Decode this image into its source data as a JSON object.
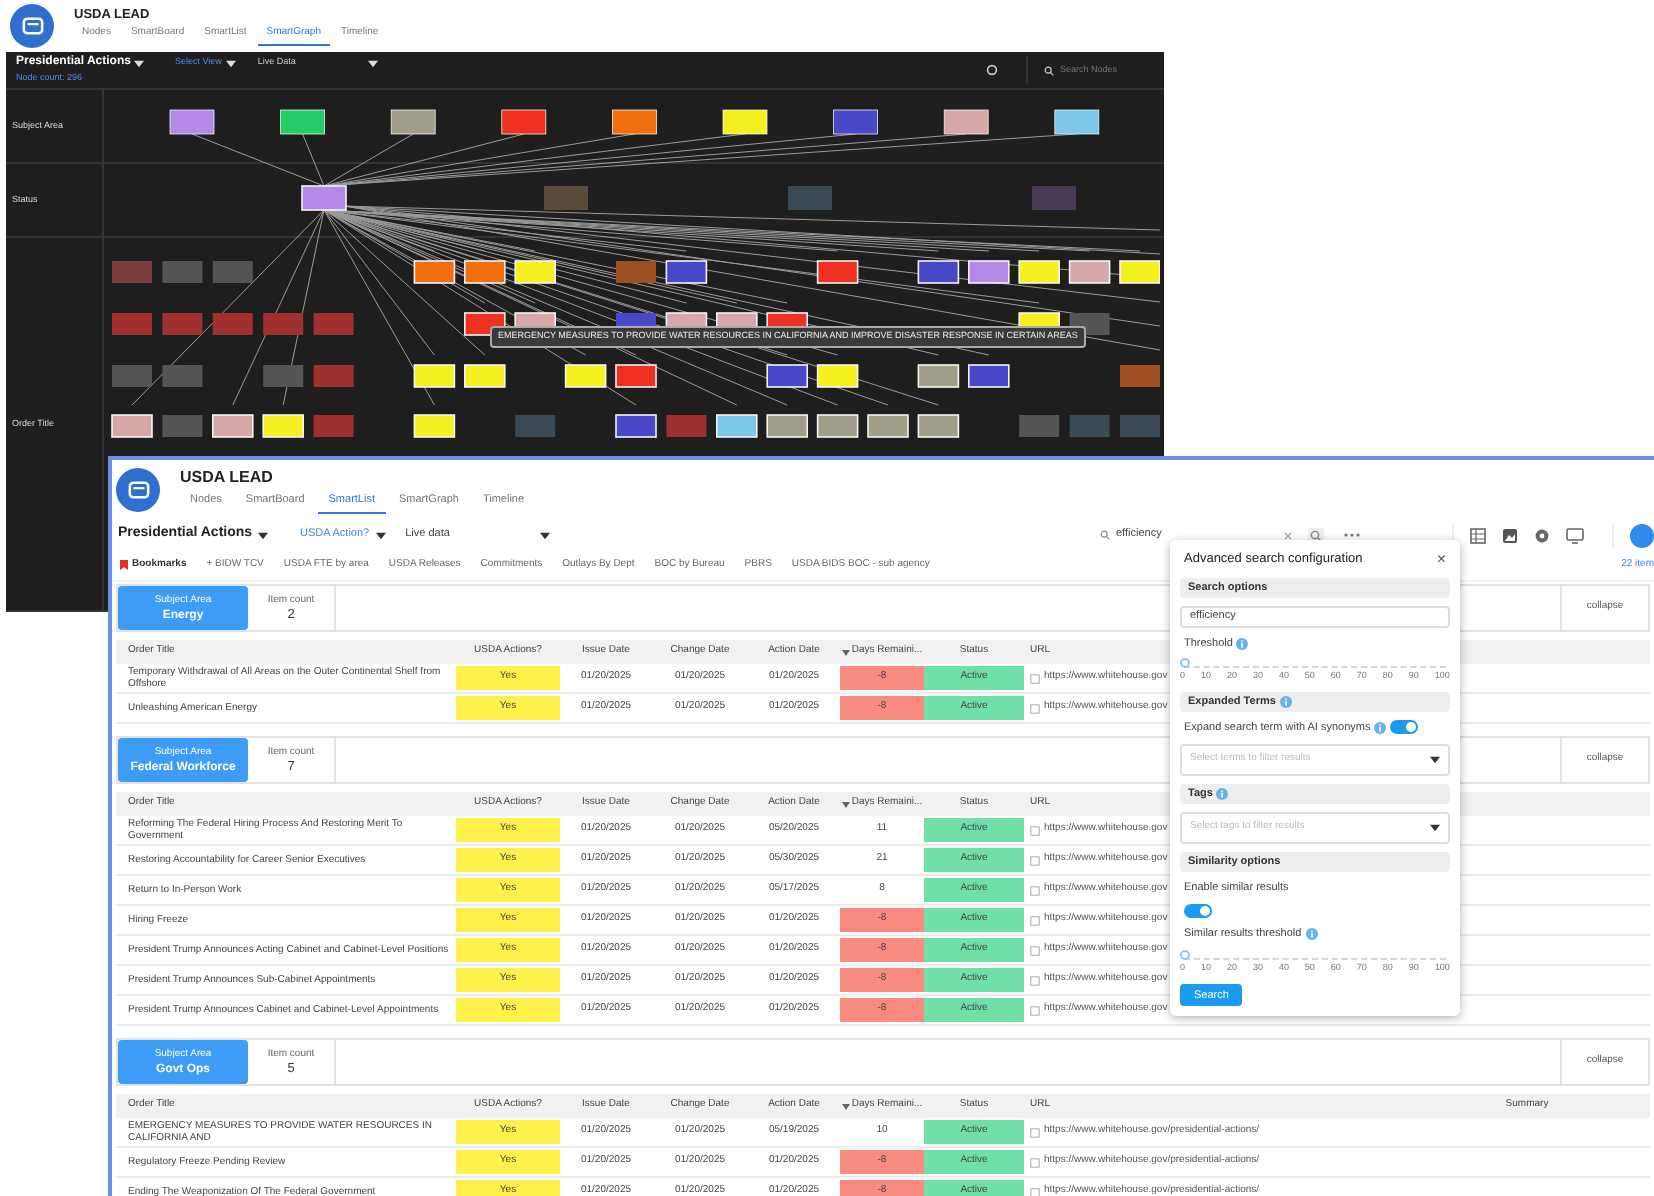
{
  "back_window": {
    "app_title": "USDA LEAD",
    "tabs": [
      {
        "label": "Nodes",
        "selected": false
      },
      {
        "label": "SmartBoard",
        "selected": false
      },
      {
        "label": "SmartList",
        "selected": false
      },
      {
        "label": "SmartGraph",
        "selected": true
      },
      {
        "label": "Timeline",
        "selected": false
      }
    ],
    "toolbar": {
      "view": "Presidential Actions",
      "select_view": "Select View",
      "data_source": "Live Data",
      "node_count": "Node count: 296",
      "search": {
        "placeholder": "Search Nodes"
      }
    },
    "lanes": [
      "Subject Area",
      "Status",
      "Order Title"
    ],
    "subject_nodes": [
      {
        "color": "#b388e8"
      },
      {
        "color": "#22cc66"
      },
      {
        "color": "#a09e88"
      },
      {
        "color": "#f03020"
      },
      {
        "color": "#f07010"
      },
      {
        "color": "#f5f020"
      },
      {
        "color": "#4848c8"
      },
      {
        "color": "#d8a8a8"
      },
      {
        "color": "#7cc8e8"
      }
    ],
    "status_nodes": [
      {
        "color": "#b388e8",
        "dimmed": false
      },
      {
        "color": "#5a4a3a",
        "dimmed": true
      },
      {
        "color": "#3a4a55",
        "dimmed": true
      },
      {
        "color": "#4a3a55",
        "dimmed": true
      }
    ],
    "order_node_rows": [
      {
        "nodes": [
          {
            "kind": "node",
            "color": "#7a4040",
            "dimmed": true
          },
          {
            "kind": "node",
            "color": "#555555",
            "dimmed": true
          },
          {
            "kind": "node",
            "color": "#555555",
            "dimmed": true
          },
          {
            "kind": "empty"
          },
          {
            "kind": "empty"
          },
          {
            "kind": "empty"
          },
          {
            "kind": "node",
            "color": "#f07010",
            "dimmed": false
          },
          {
            "kind": "node",
            "color": "#f07010",
            "dimmed": false
          },
          {
            "kind": "node",
            "color": "#f5f020",
            "dimmed": false
          },
          {
            "kind": "empty"
          },
          {
            "kind": "node",
            "color": "#a05020",
            "dimmed": true
          },
          {
            "kind": "node",
            "color": "#4848c8",
            "dimmed": false
          },
          {
            "kind": "empty"
          },
          {
            "kind": "empty"
          },
          {
            "kind": "node",
            "color": "#f03020",
            "dimmed": false
          },
          {
            "kind": "empty"
          },
          {
            "kind": "node",
            "color": "#4848c8",
            "dimmed": false
          },
          {
            "kind": "node",
            "color": "#b388e8",
            "dimmed": false
          },
          {
            "kind": "node",
            "color": "#f5f020",
            "dimmed": false
          },
          {
            "kind": "node",
            "color": "#d8a8a8",
            "dimmed": false
          },
          {
            "kind": "node",
            "color": "#f5f020",
            "dimmed": false
          }
        ]
      },
      {
        "nodes": [
          {
            "kind": "node",
            "color": "#a03030",
            "dimmed": true
          },
          {
            "kind": "node",
            "color": "#a03030",
            "dimmed": true
          },
          {
            "kind": "node",
            "color": "#a03030",
            "dimmed": true
          },
          {
            "kind": "node",
            "color": "#a03030",
            "dimmed": true
          },
          {
            "kind": "node",
            "color": "#a03030",
            "dimmed": true
          },
          {
            "kind": "empty"
          },
          {
            "kind": "empty"
          },
          {
            "kind": "node",
            "color": "#f03020",
            "dimmed": false
          },
          {
            "kind": "node",
            "color": "#d8a8a8",
            "dimmed": false
          },
          {
            "kind": "empty"
          },
          {
            "kind": "node",
            "color": "#4848c8",
            "dimmed": true
          },
          {
            "kind": "node",
            "color": "#d8a8a8",
            "dimmed": false
          },
          {
            "kind": "node",
            "color": "#d8a8a8",
            "dimmed": false
          },
          {
            "kind": "node",
            "color": "#f03020",
            "dimmed": false
          },
          {
            "kind": "empty"
          },
          {
            "kind": "empty"
          },
          {
            "kind": "empty"
          },
          {
            "kind": "empty"
          },
          {
            "kind": "node",
            "color": "#f5f020",
            "dimmed": false
          },
          {
            "kind": "node",
            "color": "#555555",
            "dimmed": true
          },
          {
            "kind": "empty"
          }
        ]
      },
      {
        "nodes": [
          {
            "kind": "node",
            "color": "#555555",
            "dimmed": true
          },
          {
            "kind": "node",
            "color": "#555555",
            "dimmed": true
          },
          {
            "kind": "empty"
          },
          {
            "kind": "node",
            "color": "#555555",
            "dimmed": true
          },
          {
            "kind": "node",
            "color": "#a03030",
            "dimmed": true
          },
          {
            "kind": "empty"
          },
          {
            "kind": "node",
            "color": "#f5f020",
            "dimmed": false
          },
          {
            "kind": "node",
            "color": "#f5f020",
            "dimmed": false
          },
          {
            "kind": "empty"
          },
          {
            "kind": "node",
            "color": "#f5f020",
            "dimmed": false
          },
          {
            "kind": "node",
            "color": "#f03020",
            "dimmed": false
          },
          {
            "kind": "empty"
          },
          {
            "kind": "empty"
          },
          {
            "kind": "node",
            "color": "#4848c8",
            "dimmed": false
          },
          {
            "kind": "node",
            "color": "#f5f020",
            "dimmed": false
          },
          {
            "kind": "empty"
          },
          {
            "kind": "node",
            "color": "#a09e88",
            "dimmed": false
          },
          {
            "kind": "node",
            "color": "#4848c8",
            "dimmed": false
          },
          {
            "kind": "empty"
          },
          {
            "kind": "empty"
          },
          {
            "kind": "node",
            "color": "#a05020",
            "dimmed": true
          }
        ]
      },
      {
        "nodes": [
          {
            "kind": "node",
            "color": "#d8a8a8",
            "dimmed": false
          },
          {
            "kind": "node",
            "color": "#555555",
            "dimmed": true
          },
          {
            "kind": "node",
            "color": "#d8a8a8",
            "dimmed": false
          },
          {
            "kind": "node",
            "color": "#f5f020",
            "dimmed": false
          },
          {
            "kind": "node",
            "color": "#a03030",
            "dimmed": true
          },
          {
            "kind": "empty"
          },
          {
            "kind": "node",
            "color": "#f5f020",
            "dimmed": false
          },
          {
            "kind": "empty"
          },
          {
            "kind": "node",
            "color": "#3a4a55",
            "dimmed": true
          },
          {
            "kind": "empty"
          },
          {
            "kind": "node",
            "color": "#4848c8",
            "dimmed": false
          },
          {
            "kind": "node",
            "color": "#a03030",
            "dimmed": true
          },
          {
            "kind": "node",
            "color": "#7cc8e8",
            "dimmed": false
          },
          {
            "kind": "node",
            "color": "#a09e88",
            "dimmed": false
          },
          {
            "kind": "node",
            "color": "#a09e88",
            "dimmed": false
          },
          {
            "kind": "node",
            "color": "#a09e88",
            "dimmed": false
          },
          {
            "kind": "node",
            "color": "#a09e88",
            "dimmed": false
          },
          {
            "kind": "empty"
          },
          {
            "kind": "node",
            "color": "#555555",
            "dimmed": true
          },
          {
            "kind": "node",
            "color": "#3a4a55",
            "dimmed": true
          },
          {
            "kind": "node",
            "color": "#3a4a55",
            "dimmed": true
          }
        ]
      }
    ],
    "tooltip": "EMERGENCY MEASURES TO PROVIDE WATER RESOURCES IN CALIFORNIA AND IMPROVE DISASTER RESPONSE IN CERTAIN AREAS"
  },
  "front_window": {
    "app_title": "USDA LEAD",
    "tabs": [
      {
        "label": "Nodes",
        "selected": false
      },
      {
        "label": "SmartBoard",
        "selected": false
      },
      {
        "label": "SmartList",
        "selected": true
      },
      {
        "label": "SmartGraph",
        "selected": false
      },
      {
        "label": "Timeline",
        "selected": false
      }
    ],
    "toolbar": {
      "view": "Presidential Actions",
      "subset": "USDA Action?",
      "data_source": "Live data",
      "search": {
        "value": "efficiency"
      },
      "items_count": "22 item"
    },
    "bookmarks": {
      "label": "Bookmarks",
      "items": [
        "+ BIDW TCV",
        "USDA FTE by area",
        "USDA Releases",
        "Commitments",
        "Outlays By Dept",
        "BOC by Bureau",
        "PBRS",
        "USDA BIDS BOC - sub agency"
      ]
    },
    "groups": [
      {
        "label": "Subject Area",
        "name": "Energy",
        "count_label": "Item count",
        "count": "2",
        "collapse": "collapse",
        "columns": [
          "Order Title",
          "USDA Actions?",
          "Issue Date",
          "Change Date",
          "Action Date",
          "Days Remaini...",
          "Status",
          "URL"
        ],
        "rows": [
          {
            "title": "Temporary Withdrawal of All Areas on the Outer Continental Shelf from Offshore",
            "usda": "Yes",
            "issue": "01/20/2025",
            "change": "01/20/2025",
            "action": "01/20/2025",
            "days": "-8",
            "overdue": true,
            "status": "Active",
            "url": "https://www.whitehouse.gov"
          },
          {
            "title": "Unleashing American Energy",
            "usda": "Yes",
            "issue": "01/20/2025",
            "change": "01/20/2025",
            "action": "01/20/2025",
            "days": "-8",
            "overdue": true,
            "status": "Active",
            "url": "https://www.whitehouse.gov"
          }
        ]
      },
      {
        "label": "Subject Area",
        "name": "Federal Workforce",
        "count_label": "Item count",
        "count": "7",
        "collapse": "collapse",
        "columns": [
          "Order Title",
          "USDA Actions?",
          "Issue Date",
          "Change Date",
          "Action Date",
          "Days Remaini...",
          "Status",
          "URL"
        ],
        "rows": [
          {
            "title": "Reforming The Federal Hiring Process And Restoring Merit To Government",
            "usda": "Yes",
            "issue": "01/20/2025",
            "change": "01/20/2025",
            "action": "05/20/2025",
            "days": "11",
            "overdue": false,
            "status": "Active",
            "url": "https://www.whitehouse.gov"
          },
          {
            "title": "Restoring Accountability for Career Senior Executives",
            "usda": "Yes",
            "issue": "01/20/2025",
            "change": "01/20/2025",
            "action": "05/30/2025",
            "days": "21",
            "overdue": false,
            "status": "Active",
            "url": "https://www.whitehouse.gov"
          },
          {
            "title": "Return to In-Person Work",
            "usda": "Yes",
            "issue": "01/20/2025",
            "change": "01/20/2025",
            "action": "05/17/2025",
            "days": "8",
            "overdue": false,
            "status": "Active",
            "url": "https://www.whitehouse.gov"
          },
          {
            "title": "Hiring Freeze",
            "usda": "Yes",
            "issue": "01/20/2025",
            "change": "01/20/2025",
            "action": "01/20/2025",
            "days": "-8",
            "overdue": true,
            "status": "Active",
            "url": "https://www.whitehouse.gov"
          },
          {
            "title": "President Trump Announces Acting Cabinet and Cabinet-Level Positions",
            "usda": "Yes",
            "issue": "01/20/2025",
            "change": "01/20/2025",
            "action": "01/20/2025",
            "days": "-8",
            "overdue": true,
            "status": "Active",
            "url": "https://www.whitehouse.gov"
          },
          {
            "title": "President Trump Announces Sub-Cabinet Appointments",
            "usda": "Yes",
            "issue": "01/20/2025",
            "change": "01/20/2025",
            "action": "01/20/2025",
            "days": "-8",
            "overdue": true,
            "status": "Active",
            "url": "https://www.whitehouse.gov"
          },
          {
            "title": "President Trump Announces Cabinet and Cabinet-Level Appointments",
            "usda": "Yes",
            "issue": "01/20/2025",
            "change": "01/20/2025",
            "action": "01/20/2025",
            "days": "-8",
            "overdue": true,
            "status": "Active",
            "url": "https://www.whitehouse.gov"
          }
        ]
      },
      {
        "label": "Subject Area",
        "name": "Govt Ops",
        "count_label": "Item count",
        "count": "5",
        "collapse": "collapse",
        "columns": [
          "Order Title",
          "USDA Actions?",
          "Issue Date",
          "Change Date",
          "Action Date",
          "Days Remaini...",
          "Status",
          "URL",
          "Summary"
        ],
        "rows": [
          {
            "title": "EMERGENCY MEASURES TO PROVIDE WATER RESOURCES IN CALIFORNIA AND",
            "usda": "Yes",
            "issue": "01/20/2025",
            "change": "01/20/2025",
            "action": "05/19/2025",
            "days": "10",
            "overdue": false,
            "status": "Active",
            "url": "https://www.whitehouse.gov/presidential-actions/"
          },
          {
            "title": "Regulatory Freeze Pending Review",
            "usda": "Yes",
            "issue": "01/20/2025",
            "change": "01/20/2025",
            "action": "01/20/2025",
            "days": "-8",
            "overdue": true,
            "status": "Active",
            "url": "https://www.whitehouse.gov/presidential-actions/"
          },
          {
            "title": "Ending The Weaponization Of The Federal Government",
            "usda": "Yes",
            "issue": "01/20/2025",
            "change": "01/20/2025",
            "action": "01/20/2025",
            "days": "-8",
            "overdue": true,
            "status": "Active",
            "url": "https://www.whitehouse.gov/presidential-actions/"
          }
        ]
      }
    ],
    "popover": {
      "title": "Advanced search configuration",
      "close": "×",
      "search_section": "Search options",
      "query": "efficiency",
      "threshold": {
        "label": "Threshold",
        "level": 0,
        "ticks": [
          "0",
          "10",
          "20",
          "30",
          "40",
          "50",
          "60",
          "70",
          "80",
          "90",
          "100"
        ]
      },
      "expanded_section": "Expanded Terms",
      "expand_toggle": {
        "label": "Expand search term with AI synonyms",
        "on": true
      },
      "terms_select": {
        "placeholder": "Select terms to filter results"
      },
      "tags_section": "Tags",
      "tags_select": {
        "placeholder": "Select tags to filter results"
      },
      "similarity_section": "Similarity options",
      "similar_toggle": {
        "label": "Enable similar results",
        "on": true
      },
      "similar_threshold": {
        "label": "Similar results threshold",
        "level": 0,
        "ticks": [
          "0",
          "10",
          "20",
          "30",
          "40",
          "50",
          "60",
          "70",
          "80",
          "90",
          "100"
        ]
      },
      "search_button": "Search"
    }
  }
}
